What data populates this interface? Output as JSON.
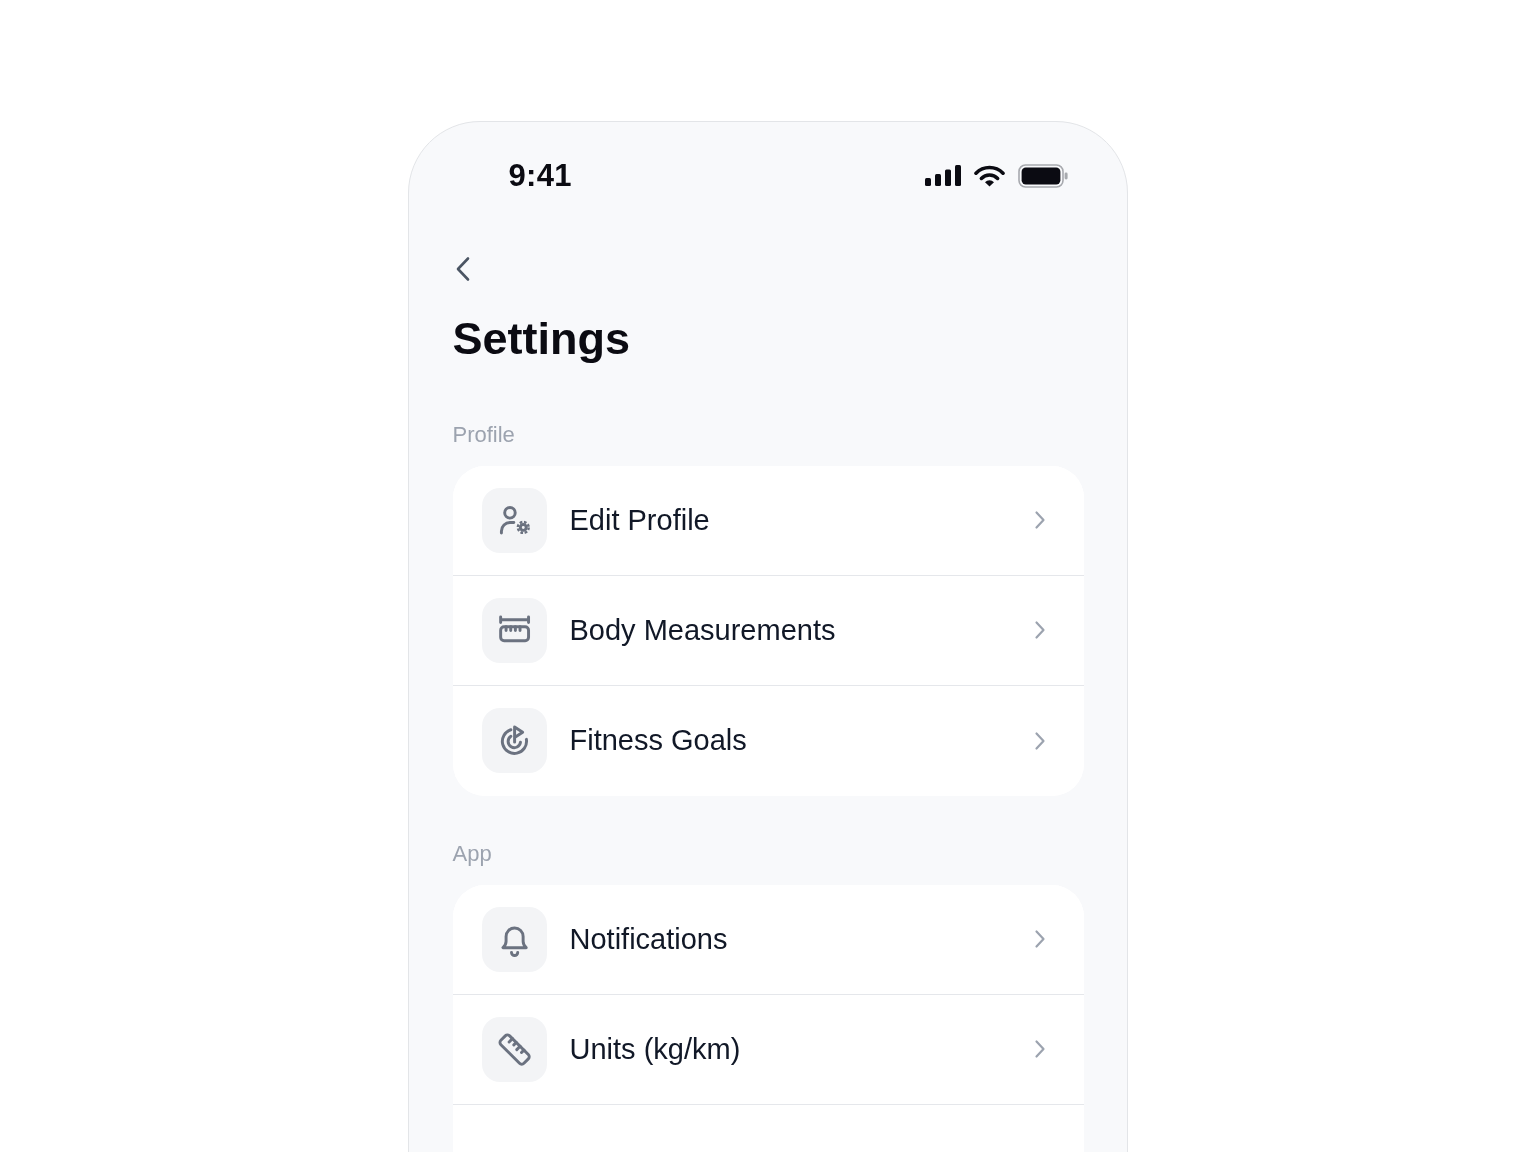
{
  "status_bar": {
    "time": "9:41"
  },
  "header": {
    "title": "Settings"
  },
  "sections": [
    {
      "title": "Profile",
      "items": [
        {
          "label": "Edit Profile"
        },
        {
          "label": "Body Measurements"
        },
        {
          "label": "Fitness Goals"
        }
      ]
    },
    {
      "title": "App",
      "items": [
        {
          "label": "Notifications"
        },
        {
          "label": "Units (kg/km)"
        }
      ]
    }
  ]
}
